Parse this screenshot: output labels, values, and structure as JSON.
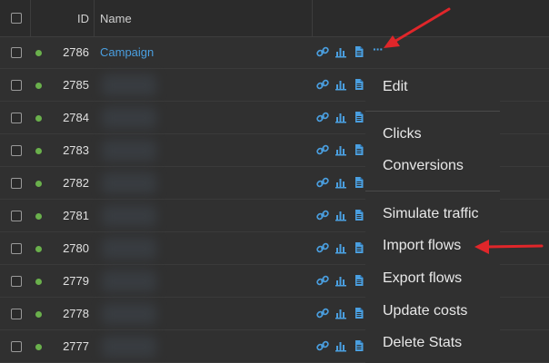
{
  "header": {
    "id_label": "ID",
    "name_label": "Name"
  },
  "rows": [
    {
      "id": "2786",
      "name": "Campaign"
    },
    {
      "id": "2785",
      "name": ""
    },
    {
      "id": "2784",
      "name": ""
    },
    {
      "id": "2783",
      "name": ""
    },
    {
      "id": "2782",
      "name": ""
    },
    {
      "id": "2781",
      "name": ""
    },
    {
      "id": "2780",
      "name": ""
    },
    {
      "id": "2779",
      "name": ""
    },
    {
      "id": "2778",
      "name": ""
    },
    {
      "id": "2777",
      "name": ""
    }
  ],
  "more_button": "···",
  "menu": {
    "edit": "Edit",
    "clicks": "Clicks",
    "conversions": "Conversions",
    "simulate_traffic": "Simulate traffic",
    "import_flows": "Import flows",
    "export_flows": "Export flows",
    "update_costs": "Update costs",
    "delete_stats": "Delete Stats"
  },
  "colors": {
    "link": "#4a9fe0",
    "status_active": "#6ab04c",
    "annotation_arrow": "#e0262a"
  }
}
